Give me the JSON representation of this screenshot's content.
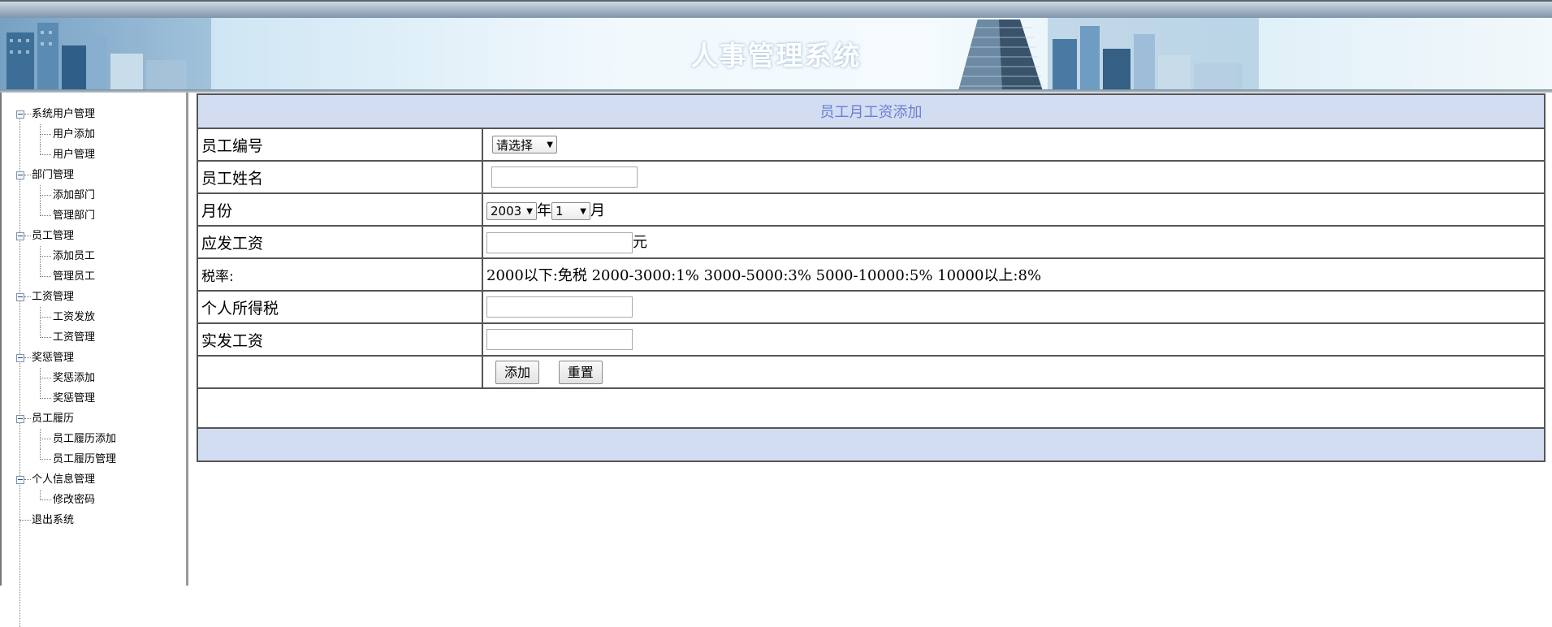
{
  "app": {
    "title": "人事管理系统"
  },
  "colors": {
    "header_bg": "#d3ddf2",
    "header_text": "#6b7fd0",
    "border": "#555555"
  },
  "sidebar": {
    "categories": [
      {
        "label": "系统用户管理",
        "items": [
          "用户添加",
          "用户管理"
        ]
      },
      {
        "label": "部门管理",
        "items": [
          "添加部门",
          "管理部门"
        ]
      },
      {
        "label": "员工管理",
        "items": [
          "添加员工",
          "管理员工"
        ]
      },
      {
        "label": "工资管理",
        "items": [
          "工资发放",
          "工资管理"
        ]
      },
      {
        "label": "奖惩管理",
        "items": [
          "奖惩添加",
          "奖惩管理"
        ]
      },
      {
        "label": "员工履历",
        "items": [
          "员工履历添加",
          "员工履历管理"
        ]
      },
      {
        "label": "个人信息管理",
        "items": [
          "修改密码"
        ]
      }
    ],
    "exit_label": "退出系统",
    "icons": {
      "expand": "minus-box-icon"
    }
  },
  "form": {
    "title": "员工月工资添加",
    "employee_id": {
      "label": "员工编号",
      "selected": "请选择"
    },
    "employee_name": {
      "label": "员工姓名",
      "value": ""
    },
    "month": {
      "label": "月份",
      "year": "2003",
      "year_suffix": "年",
      "month": "1",
      "month_suffix": "月"
    },
    "gross_pay": {
      "label": "应发工资",
      "value": "",
      "unit": "元"
    },
    "tax_rate": {
      "label": "税率:",
      "text": "2000以下:免税 2000-3000:1% 3000-5000:3% 5000-10000:5% 10000以上:8%"
    },
    "income_tax": {
      "label": "个人所得税",
      "value": ""
    },
    "net_pay": {
      "label": "实发工资",
      "value": ""
    },
    "buttons": {
      "add": "添加",
      "reset": "重置"
    }
  }
}
